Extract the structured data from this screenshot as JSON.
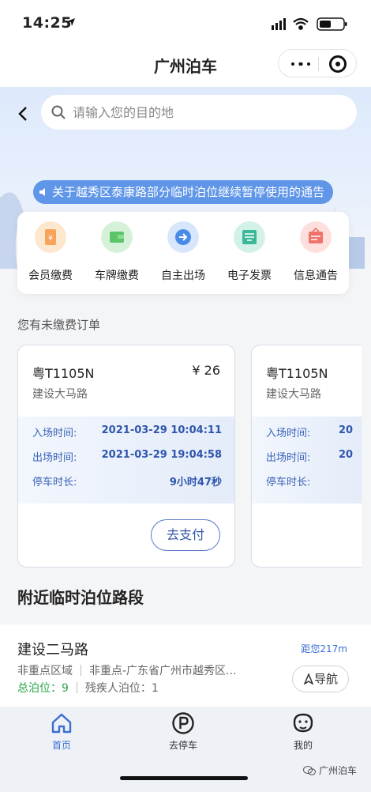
{
  "status": {
    "time": "14:25"
  },
  "navbar": {
    "title": "广州泊车"
  },
  "search": {
    "placeholder": "请输入您的目的地"
  },
  "notice": {
    "text": "关于越秀区泰康路部分临时泊位继续暂停使用的通告"
  },
  "menu": [
    {
      "label": "会员缴费",
      "icon": "member-card-icon",
      "color": "#f6a35c",
      "bg": "#fde7cf"
    },
    {
      "label": "车牌缴费",
      "icon": "wallet-icon",
      "color": "#5cc56a",
      "bg": "#d6f1d9"
    },
    {
      "label": "自主出场",
      "icon": "exit-arrow-icon",
      "color": "#4a8be8",
      "bg": "#d7e6fb"
    },
    {
      "label": "电子发票",
      "icon": "invoice-icon",
      "color": "#3bb89a",
      "bg": "#d2f1e8"
    },
    {
      "label": "信息通告",
      "icon": "notice-board-icon",
      "color": "#f0726a",
      "bg": "#fde0dd"
    }
  ],
  "orders": {
    "section_title": "您有未缴费订单",
    "items": [
      {
        "plate": "粤T1105N",
        "price": "¥ 26",
        "road": "建设大马路",
        "entry_label": "入场时间:",
        "entry_time": "2021-03-29 10:04:11",
        "exit_label": "出场时间:",
        "exit_time": "2021-03-29 19:04:58",
        "duration_label": "停车时长:",
        "duration": "9小时47秒",
        "pay_label": "去支付"
      },
      {
        "plate": "粤T1105N",
        "road": "建设大马路",
        "entry_label": "入场时间:",
        "entry_time_partial": "20",
        "exit_label": "出场时间:",
        "exit_time_partial": "20",
        "duration_label": "停车时长:"
      }
    ]
  },
  "nearby": {
    "title": "附近临时泊位路段",
    "name": "建设二马路",
    "distance": "距您217m",
    "zone": "非重点区域",
    "address": "非重点-广东省广州市越秀区...",
    "total_label": "总泊位：",
    "total": "9",
    "disabled_label": "残疾人泊位：",
    "disabled": "1",
    "nav_label": "导航"
  },
  "tabs": [
    {
      "label": "首页",
      "icon": "home-icon",
      "active": true
    },
    {
      "label": "去停车",
      "icon": "parking-icon",
      "active": false
    },
    {
      "label": "我的",
      "icon": "profile-icon",
      "active": false
    }
  ],
  "watermark": "广州泊车",
  "colors": {
    "accent": "#3b6ed3",
    "notice_bg": "#5f96e8",
    "green": "#2aa64a"
  }
}
